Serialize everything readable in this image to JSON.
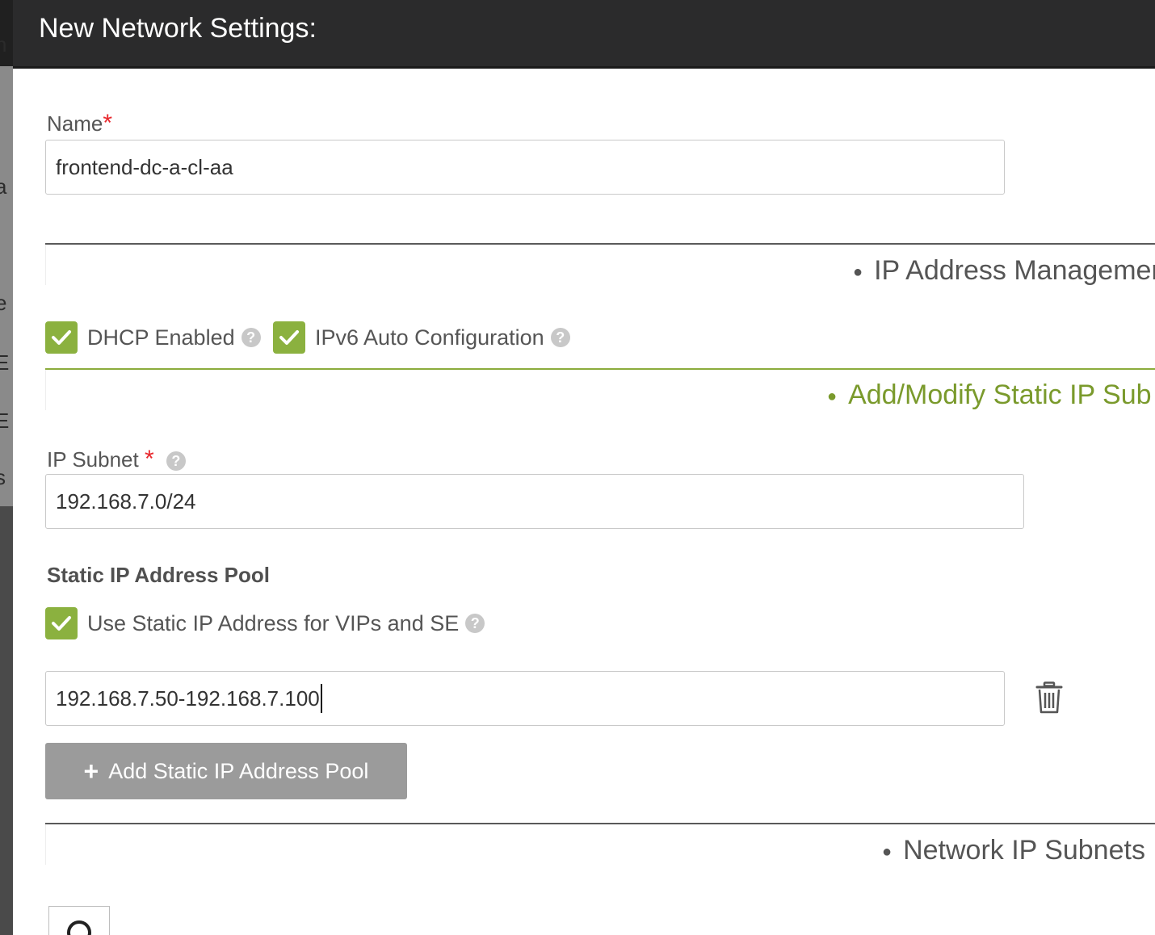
{
  "background": {
    "fragments": [
      "n",
      "a",
      "e",
      "E",
      "E",
      "s"
    ]
  },
  "modal": {
    "title": "New Network Settings:"
  },
  "name_field": {
    "label": "Name",
    "required_mark": "*",
    "value": "frontend-dc-a-cl-aa"
  },
  "ip_mgmt_section": {
    "title": "IP Address Managemer"
  },
  "checkboxes": {
    "dhcp": {
      "label": "DHCP Enabled",
      "checked": true
    },
    "ipv6": {
      "label": "IPv6 Auto Configuration",
      "checked": true
    }
  },
  "static_section": {
    "title": "Add/Modify Static IP Sub"
  },
  "subnet_field": {
    "label": "IP Subnet",
    "required_mark": "*",
    "value": "192.168.7.0/24"
  },
  "pool": {
    "heading": "Static IP Address Pool",
    "use_static": {
      "label": "Use Static IP Address for VIPs and SE",
      "checked": true
    },
    "range_value": "192.168.7.50-192.168.7.100",
    "add_button_label": "Add Static IP Address Pool"
  },
  "subnets_section": {
    "title": "Network IP Subnets"
  },
  "icons": {
    "help": "question-circle-icon",
    "check": "check-icon",
    "trash": "trash-icon",
    "plus": "plus-icon",
    "search": "search-icon"
  },
  "colors": {
    "header_bg": "#2b2b2c",
    "accent_green": "#8bb13f",
    "section_green": "#7a9a2c",
    "required_red": "#e8272c",
    "button_gray": "#9b9b9b"
  }
}
